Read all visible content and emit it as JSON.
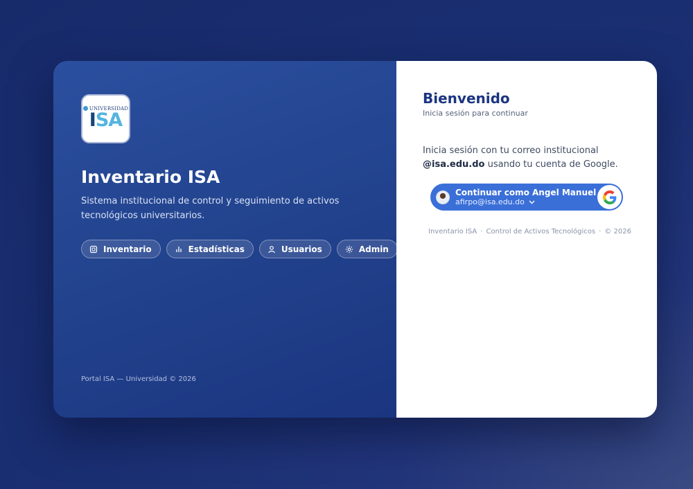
{
  "brand": {
    "logo_top": "UNIVERSIDAD",
    "logo_main_a": "I",
    "logo_main_s": "S",
    "logo_main_b": "A",
    "title": "Inventario ISA",
    "subtitle": "Sistema institucional de control y seguimiento de activos tecnológicos universitarios.",
    "footer": "Portal ISA — Universidad © 2026"
  },
  "chips": [
    {
      "label": "Inventario",
      "icon": "box-icon"
    },
    {
      "label": "Estadísticas",
      "icon": "bar-chart-icon"
    },
    {
      "label": "Usuarios",
      "icon": "user-icon"
    },
    {
      "label": "Admin",
      "icon": "settings-icon"
    }
  ],
  "login": {
    "heading": "Bienvenido",
    "subheading": "Inicia sesión para continuar",
    "instruction_pre": "Inicia sesión con tu correo institucional",
    "instruction_domain": "@isa.edu.do",
    "instruction_post": " usando tu cuenta de Google.",
    "google_button": {
      "name": "Continuar como Angel Manuel",
      "email": "afirpo@isa.edu.do"
    },
    "footer": [
      "Inventario ISA",
      "Control de Activos Tecnológicos",
      "© 2026"
    ],
    "footer_separator": "·"
  },
  "colors": {
    "page_bg": "#1a2f72",
    "panel_left": "#23448f",
    "accent": "#1b3580",
    "google_button": "#3a6fd8"
  }
}
